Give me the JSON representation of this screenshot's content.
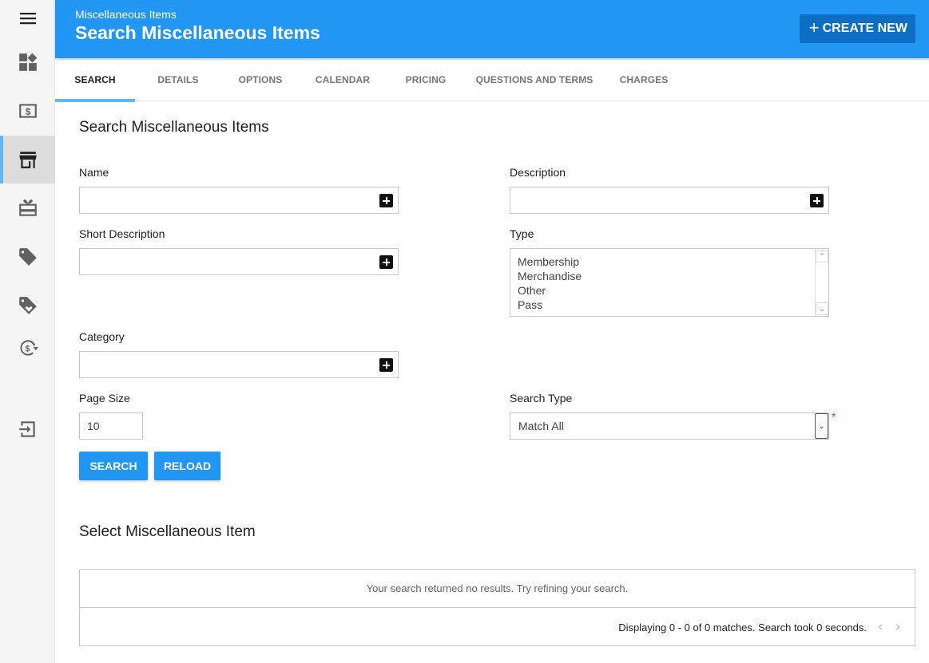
{
  "header": {
    "breadcrumb": "Miscellaneous Items",
    "title": "Search Miscellaneous Items",
    "create_label": "CREATE NEW",
    "create_icon": "plus-icon"
  },
  "sidebar": {
    "items": [
      {
        "name": "menu",
        "icon": "hamburger-menu-icon"
      },
      {
        "name": "dashboard",
        "icon": "dashboard-widgets-icon"
      },
      {
        "name": "payments",
        "icon": "dollar-bill-icon"
      },
      {
        "name": "store",
        "icon": "storefront-icon",
        "active": true
      },
      {
        "name": "gift-cards",
        "icon": "gift-card-icon"
      },
      {
        "name": "tags",
        "icon": "tag-icon"
      },
      {
        "name": "loyalty",
        "icon": "tag-heart-icon"
      },
      {
        "name": "refunds",
        "icon": "currency-exchange-icon"
      },
      {
        "name": "logout",
        "icon": "logout-icon"
      }
    ]
  },
  "tabs": [
    {
      "label": "SEARCH",
      "active": true
    },
    {
      "label": "DETAILS"
    },
    {
      "label": "OPTIONS"
    },
    {
      "label": "CALENDAR"
    },
    {
      "label": "PRICING"
    },
    {
      "label": "QUESTIONS AND TERMS"
    },
    {
      "label": "CHARGES"
    }
  ],
  "search": {
    "section_title": "Search Miscellaneous Items",
    "name_label": "Name",
    "name_value": "",
    "description_label": "Description",
    "description_value": "",
    "short_description_label": "Short Description",
    "short_description_value": "",
    "type_label": "Type",
    "type_options": [
      "Membership",
      "Merchandise",
      "Other",
      "Pass"
    ],
    "category_label": "Category",
    "category_value": "",
    "page_size_label": "Page Size",
    "page_size_value": "10",
    "search_type_label": "Search Type",
    "search_type_value": "Match All",
    "required_marker": "*",
    "search_button": "SEARCH",
    "reload_button": "RELOAD"
  },
  "results": {
    "section_title": "Select Miscellaneous Item",
    "empty_message": "Your search returned no results. Try refining your search.",
    "summary": "Displaying 0 - 0 of 0 matches. Search took 0 seconds.",
    "prev_icon": "‹",
    "next_icon": "›"
  },
  "colors": {
    "primary": "#2196f3",
    "primary_dark": "#0d6ec4",
    "tab_indicator": "#64b5f6",
    "required": "#e53935"
  }
}
